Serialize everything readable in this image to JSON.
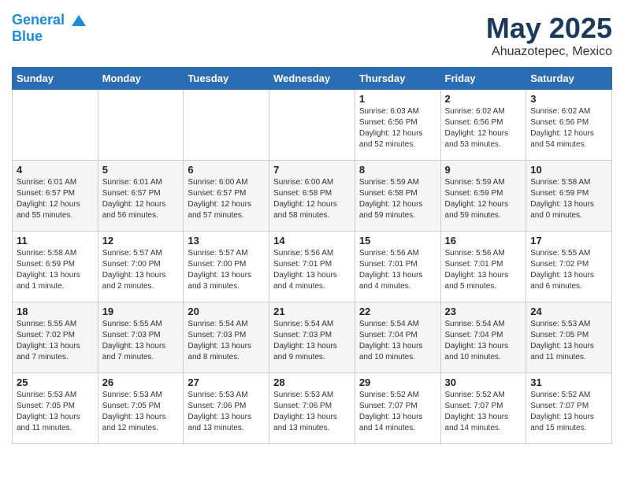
{
  "header": {
    "logo_line1": "General",
    "logo_line2": "Blue",
    "month": "May 2025",
    "location": "Ahuazotepec, Mexico"
  },
  "weekdays": [
    "Sunday",
    "Monday",
    "Tuesday",
    "Wednesday",
    "Thursday",
    "Friday",
    "Saturday"
  ],
  "weeks": [
    [
      {
        "date": "",
        "text": ""
      },
      {
        "date": "",
        "text": ""
      },
      {
        "date": "",
        "text": ""
      },
      {
        "date": "",
        "text": ""
      },
      {
        "date": "1",
        "text": "Sunrise: 6:03 AM\nSunset: 6:56 PM\nDaylight: 12 hours and 52 minutes."
      },
      {
        "date": "2",
        "text": "Sunrise: 6:02 AM\nSunset: 6:56 PM\nDaylight: 12 hours and 53 minutes."
      },
      {
        "date": "3",
        "text": "Sunrise: 6:02 AM\nSunset: 6:56 PM\nDaylight: 12 hours and 54 minutes."
      }
    ],
    [
      {
        "date": "4",
        "text": "Sunrise: 6:01 AM\nSunset: 6:57 PM\nDaylight: 12 hours and 55 minutes."
      },
      {
        "date": "5",
        "text": "Sunrise: 6:01 AM\nSunset: 6:57 PM\nDaylight: 12 hours and 56 minutes."
      },
      {
        "date": "6",
        "text": "Sunrise: 6:00 AM\nSunset: 6:57 PM\nDaylight: 12 hours and 57 minutes."
      },
      {
        "date": "7",
        "text": "Sunrise: 6:00 AM\nSunset: 6:58 PM\nDaylight: 12 hours and 58 minutes."
      },
      {
        "date": "8",
        "text": "Sunrise: 5:59 AM\nSunset: 6:58 PM\nDaylight: 12 hours and 59 minutes."
      },
      {
        "date": "9",
        "text": "Sunrise: 5:59 AM\nSunset: 6:59 PM\nDaylight: 12 hours and 59 minutes."
      },
      {
        "date": "10",
        "text": "Sunrise: 5:58 AM\nSunset: 6:59 PM\nDaylight: 13 hours and 0 minutes."
      }
    ],
    [
      {
        "date": "11",
        "text": "Sunrise: 5:58 AM\nSunset: 6:59 PM\nDaylight: 13 hours and 1 minute."
      },
      {
        "date": "12",
        "text": "Sunrise: 5:57 AM\nSunset: 7:00 PM\nDaylight: 13 hours and 2 minutes."
      },
      {
        "date": "13",
        "text": "Sunrise: 5:57 AM\nSunset: 7:00 PM\nDaylight: 13 hours and 3 minutes."
      },
      {
        "date": "14",
        "text": "Sunrise: 5:56 AM\nSunset: 7:01 PM\nDaylight: 13 hours and 4 minutes."
      },
      {
        "date": "15",
        "text": "Sunrise: 5:56 AM\nSunset: 7:01 PM\nDaylight: 13 hours and 4 minutes."
      },
      {
        "date": "16",
        "text": "Sunrise: 5:56 AM\nSunset: 7:01 PM\nDaylight: 13 hours and 5 minutes."
      },
      {
        "date": "17",
        "text": "Sunrise: 5:55 AM\nSunset: 7:02 PM\nDaylight: 13 hours and 6 minutes."
      }
    ],
    [
      {
        "date": "18",
        "text": "Sunrise: 5:55 AM\nSunset: 7:02 PM\nDaylight: 13 hours and 7 minutes."
      },
      {
        "date": "19",
        "text": "Sunrise: 5:55 AM\nSunset: 7:03 PM\nDaylight: 13 hours and 7 minutes."
      },
      {
        "date": "20",
        "text": "Sunrise: 5:54 AM\nSunset: 7:03 PM\nDaylight: 13 hours and 8 minutes."
      },
      {
        "date": "21",
        "text": "Sunrise: 5:54 AM\nSunset: 7:03 PM\nDaylight: 13 hours and 9 minutes."
      },
      {
        "date": "22",
        "text": "Sunrise: 5:54 AM\nSunset: 7:04 PM\nDaylight: 13 hours and 10 minutes."
      },
      {
        "date": "23",
        "text": "Sunrise: 5:54 AM\nSunset: 7:04 PM\nDaylight: 13 hours and 10 minutes."
      },
      {
        "date": "24",
        "text": "Sunrise: 5:53 AM\nSunset: 7:05 PM\nDaylight: 13 hours and 11 minutes."
      }
    ],
    [
      {
        "date": "25",
        "text": "Sunrise: 5:53 AM\nSunset: 7:05 PM\nDaylight: 13 hours and 11 minutes."
      },
      {
        "date": "26",
        "text": "Sunrise: 5:53 AM\nSunset: 7:05 PM\nDaylight: 13 hours and 12 minutes."
      },
      {
        "date": "27",
        "text": "Sunrise: 5:53 AM\nSunset: 7:06 PM\nDaylight: 13 hours and 13 minutes."
      },
      {
        "date": "28",
        "text": "Sunrise: 5:53 AM\nSunset: 7:06 PM\nDaylight: 13 hours and 13 minutes."
      },
      {
        "date": "29",
        "text": "Sunrise: 5:52 AM\nSunset: 7:07 PM\nDaylight: 13 hours and 14 minutes."
      },
      {
        "date": "30",
        "text": "Sunrise: 5:52 AM\nSunset: 7:07 PM\nDaylight: 13 hours and 14 minutes."
      },
      {
        "date": "31",
        "text": "Sunrise: 5:52 AM\nSunset: 7:07 PM\nDaylight: 13 hours and 15 minutes."
      }
    ]
  ]
}
